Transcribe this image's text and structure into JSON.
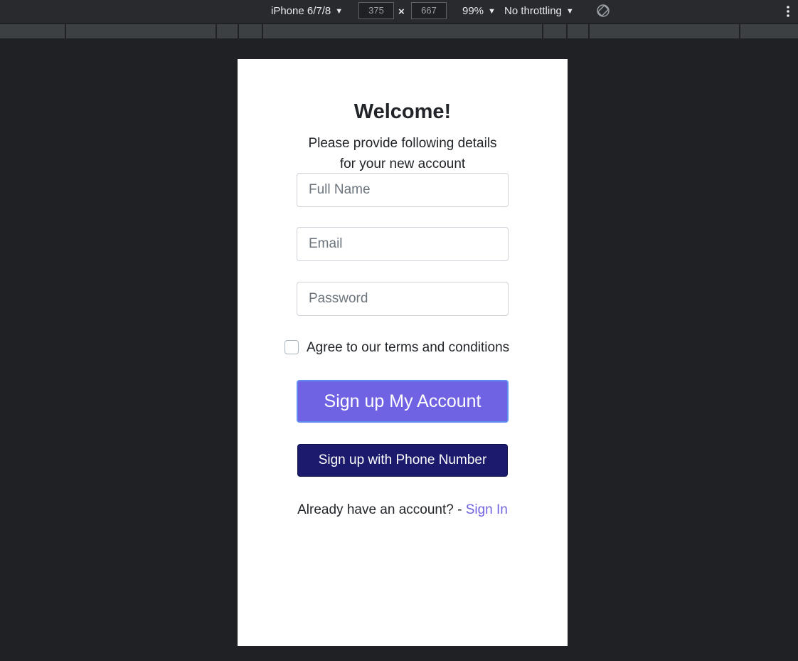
{
  "devtools": {
    "device": "iPhone 6/7/8",
    "width_value": "375",
    "height_value": "667",
    "dimension_separator": "×",
    "zoom": "99%",
    "throttling": "No throttling",
    "icons": [
      "rotate-icon",
      "kebab-menu-icon",
      "dropdown-caret-icon"
    ]
  },
  "page": {
    "title": "Welcome!",
    "subtitle": "Please provide following details for your new account",
    "fields": {
      "full_name_placeholder": "Full Name",
      "email_placeholder": "Email",
      "password_placeholder": "Password"
    },
    "terms_label": "Agree to our terms and conditions",
    "terms_checked": false,
    "primary_button": "Sign up My Account",
    "phone_button": "Sign up with Phone Number",
    "signin_prompt": "Already have an account? - ",
    "signin_link": "Sign In"
  },
  "colors": {
    "primary_button": "#7063e3",
    "phone_button": "#1b1a6c",
    "link": "#6f63e0",
    "devtools_background": "#202124"
  }
}
